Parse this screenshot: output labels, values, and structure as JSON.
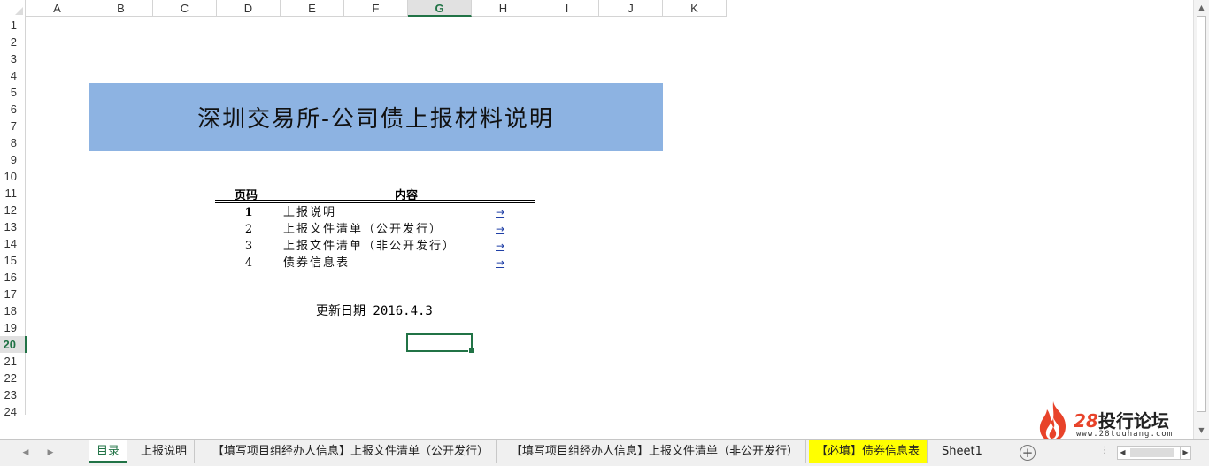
{
  "columns": [
    "A",
    "B",
    "C",
    "D",
    "E",
    "F",
    "G",
    "H",
    "I",
    "J",
    "K"
  ],
  "active_column": "G",
  "rows": [
    "1",
    "2",
    "3",
    "4",
    "5",
    "6",
    "7",
    "8",
    "9",
    "10",
    "11",
    "12",
    "13",
    "14",
    "15",
    "16",
    "17",
    "18",
    "19",
    "20",
    "21",
    "22",
    "23",
    "24"
  ],
  "active_row": "20",
  "sheet": {
    "title": "深圳交易所-公司债上报材料说明",
    "toc_header_page": "页码",
    "toc_header_content": "内容",
    "toc": [
      {
        "num": "1",
        "label": "上报说明",
        "link": "→"
      },
      {
        "num": "2",
        "label": "上报文件清单（公开发行）",
        "link": "→"
      },
      {
        "num": "3",
        "label": "上报文件清单（非公开发行）",
        "link": "→"
      },
      {
        "num": "4",
        "label": "债券信息表",
        "link": "→"
      }
    ],
    "updated": "更新日期 2016.4.3"
  },
  "tabs": [
    {
      "label": "目录",
      "active": true
    },
    {
      "label": "上报说明"
    },
    {
      "label": "【填写项目组经办人信息】上报文件清单（公开发行）"
    },
    {
      "label": "【填写项目组经办人信息】上报文件清单（非公开发行）"
    },
    {
      "label": "【必填】债券信息表",
      "highlight": "#ffff00"
    },
    {
      "label": "Sheet1"
    }
  ],
  "watermark": {
    "number": "28",
    "name": "投行论坛",
    "site": "www.28touhang.com"
  },
  "colors": {
    "accent": "#217346",
    "banner": "#8db3e2",
    "link": "#1f3fa6"
  }
}
